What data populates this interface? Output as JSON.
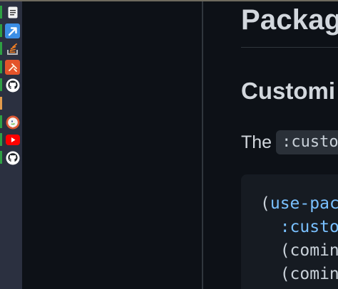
{
  "dock": {
    "items": [
      {
        "name": "notes",
        "icon": "document-icon",
        "indicator": "#2ea043"
      },
      {
        "name": "arrow-app",
        "icon": "arrow-up-right-icon",
        "indicator": "#2ea043"
      },
      {
        "name": "stackoverflow",
        "icon": "stack-overflow-icon",
        "indicator": "#2ea043"
      },
      {
        "name": "tool",
        "icon": "orange-tool-icon",
        "indicator": "#2ea043"
      },
      {
        "name": "github-1",
        "icon": "github-icon",
        "indicator": "#2ea043"
      },
      {
        "name": "blank",
        "icon": "",
        "indicator": "#e39b4c"
      },
      {
        "name": "duckduckgo",
        "icon": "duckduckgo-icon",
        "indicator": "#2ea043"
      },
      {
        "name": "youtube",
        "icon": "youtube-icon",
        "indicator": "#2ea043"
      },
      {
        "name": "github-2",
        "icon": "github-icon",
        "indicator": "#2ea043"
      }
    ]
  },
  "doc": {
    "heading": "Packag",
    "subheading": "Customi",
    "paragraph_text": "The",
    "paragraph_code": ":custo",
    "code_lines": [
      {
        "a": "(",
        "b": "use-pac",
        "c": ""
      },
      {
        "a": "  ",
        "b": ":custo",
        "c": ""
      },
      {
        "a": "  (comin",
        "b": "",
        "c": ""
      },
      {
        "a": "  (comin",
        "b": "",
        "c": ""
      }
    ]
  },
  "colors": {
    "background": "#0d1117",
    "dock": "#2b3040",
    "heading": "#d2d7dd",
    "keyword": "#79c0ff"
  }
}
